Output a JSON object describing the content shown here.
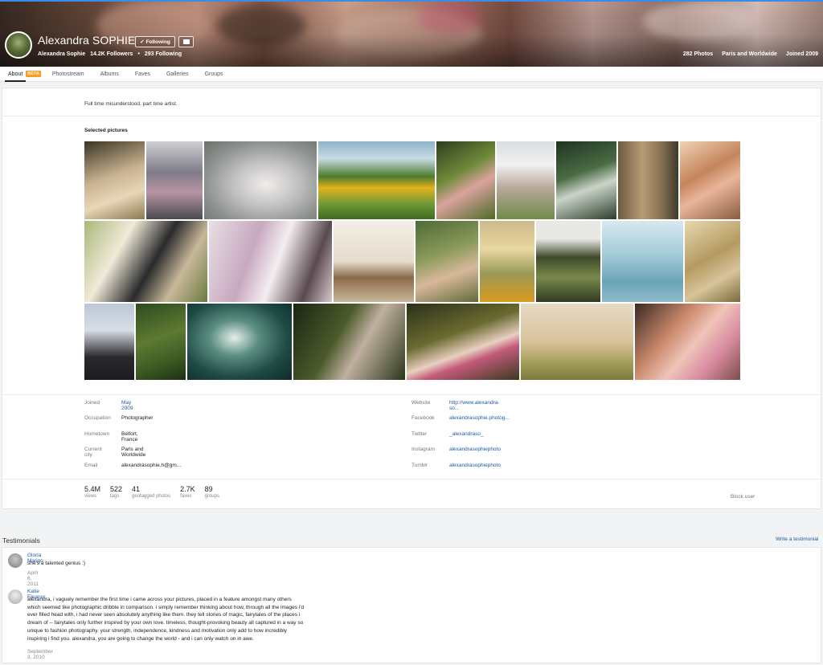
{
  "profile": {
    "name": "Alexandra SOPHIE",
    "follow_label": "Following",
    "display_name": "Alexandra Sophie",
    "followers": "14.2K Followers",
    "following": "293 Following",
    "photos_count": "282 Photos",
    "location": "Paris and Worldwide",
    "joined": "Joined 2009"
  },
  "nav": {
    "tabs": [
      {
        "label": "About"
      },
      {
        "label": "Photostream"
      },
      {
        "label": "Albums"
      },
      {
        "label": "Faves"
      },
      {
        "label": "Galleries"
      },
      {
        "label": "Groups"
      }
    ],
    "beta": "BETA"
  },
  "about": {
    "description": "Full time misunderstood, part time artist.",
    "selected_title": "Selected pictures"
  },
  "info_left": [
    {
      "label": "Joined",
      "value": "May 2009"
    },
    {
      "label": "Occupation",
      "value": "Photographer"
    },
    {
      "label": "Hometown",
      "value": "Belfort, France"
    },
    {
      "label": "Current city",
      "value": "Paris and Worldwide"
    },
    {
      "label": "Email",
      "value": "alexandrasophie.h@gm..."
    }
  ],
  "info_right": [
    {
      "label": "Website",
      "value": "http://www.alexandra-so..."
    },
    {
      "label": "Facebook",
      "value": "alexandrasophie.photog..."
    },
    {
      "label": "Twitter",
      "value": "_alexandraso_"
    },
    {
      "label": "Instagram",
      "value": "alexandrasophiephoto"
    },
    {
      "label": "Tumblr",
      "value": "alexandrasophiephoto"
    }
  ],
  "stats": [
    {
      "num": "5.4M",
      "label": "views"
    },
    {
      "num": "522",
      "label": "tags"
    },
    {
      "num": "41",
      "label": "geotagged photos"
    },
    {
      "num": "2.7K",
      "label": "faves"
    },
    {
      "num": "89",
      "label": "groups"
    }
  ],
  "block_label": "Block user",
  "testimonials": {
    "title": "Testimonials",
    "write_label": "Write a testimonial",
    "items": [
      {
        "name": "Gloria Marigo",
        "text": "she's a talented genius :)",
        "date": "April 6, 2011"
      },
      {
        "name": "Katie Eleanor",
        "text": "alexandra, i vaguely remember the first time i came across your pictures, placed in a feature amongst many others which seemed like photographic dribble in comparison. i simply remember thinking about how, through all the images i'd ever filled head with, i had never seen absolutely anything like them. they tell stories of magic, fairytales of the places i dream of -- fairytales only further inspired by your own love. timeless, thought-provoking beauty all captured in a way so unique to fashion photography. your strength, independence, kindness and motivation only add to how incredibly inspiring i find you. alexandra, you are going to change the world - and i can only watch on in awe.",
        "date": "September 3, 2010"
      }
    ]
  },
  "colors": {
    "link": "#1c5ba5",
    "beta": "#ff9a1f",
    "topline": "#3d8be8"
  }
}
